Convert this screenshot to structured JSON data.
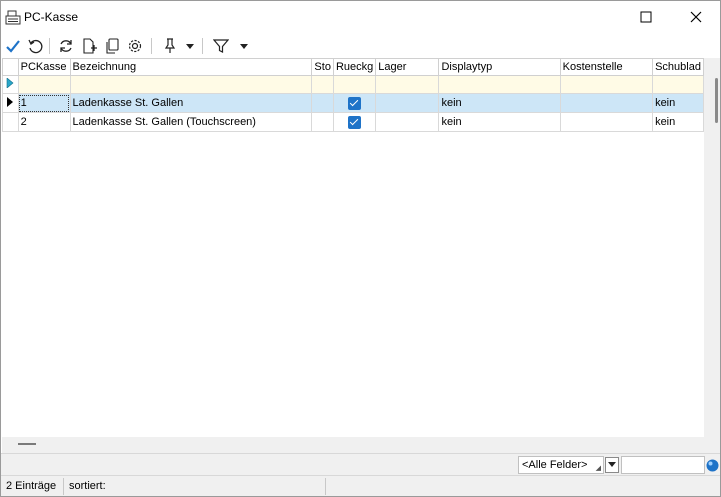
{
  "window": {
    "title": "PC-Kasse"
  },
  "grid": {
    "columns": [
      "PCKasse",
      "Bezeichnung",
      "Sto",
      "Rueckg",
      "Lager",
      "Displaytyp",
      "Kostenstelle",
      "Schublad"
    ],
    "rows": [
      {
        "pckasse": "1",
        "bezeichnung": "Ladenkasse St. Gallen",
        "sto": "",
        "rueckg": true,
        "lager": "",
        "displaytyp": "kein",
        "kostenstelle": "",
        "schublade": "kein"
      },
      {
        "pckasse": "2",
        "bezeichnung": "Ladenkasse St. Gallen (Touchscreen)",
        "sto": "",
        "rueckg": true,
        "lager": "",
        "displaytyp": "kein",
        "kostenstelle": "",
        "schublade": "kein"
      }
    ]
  },
  "search": {
    "field_selected": "<Alle Felder>",
    "value": ""
  },
  "status": {
    "count": "2 Einträge",
    "sorted": "sortiert:",
    "extra": ""
  },
  "colors": {
    "accent": "#1e73c8",
    "selected_row": "#cde6f7",
    "filter_row": "#fffbe6",
    "confirm_icon": "#1e73c8"
  }
}
